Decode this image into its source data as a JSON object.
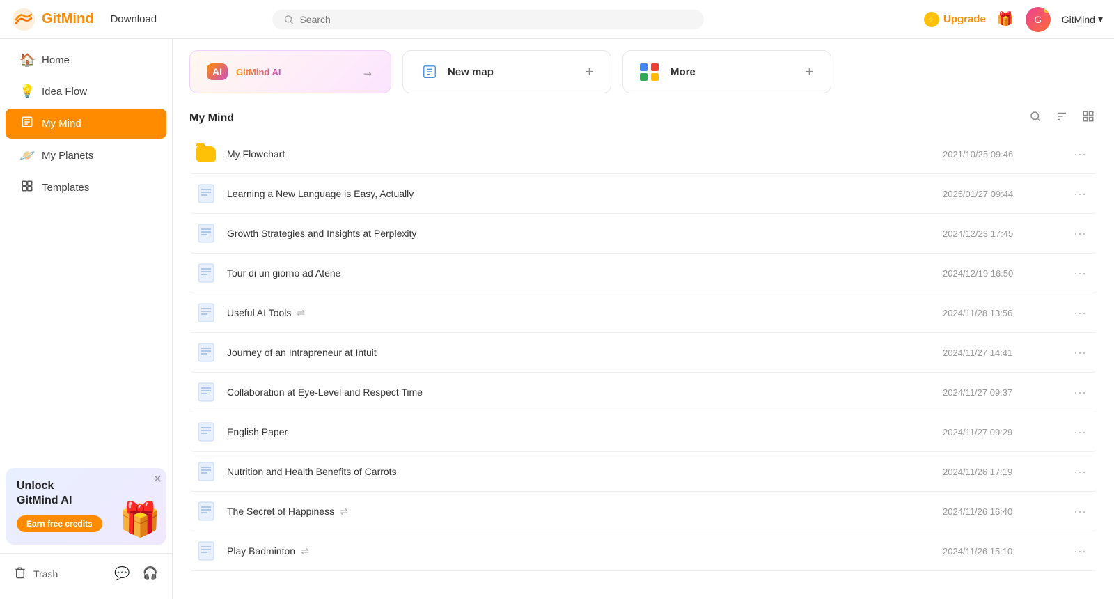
{
  "header": {
    "logo_text": "GitMind",
    "download_label": "Download",
    "search_placeholder": "Search",
    "upgrade_label": "Upgrade",
    "user_name": "GitMind",
    "user_chevron": "▾"
  },
  "sidebar": {
    "items": [
      {
        "id": "home",
        "label": "Home",
        "icon": "🏠"
      },
      {
        "id": "idea-flow",
        "label": "Idea Flow",
        "icon": "💡"
      },
      {
        "id": "my-mind",
        "label": "My Mind",
        "icon": "📋",
        "active": true
      },
      {
        "id": "my-planets",
        "label": "My Planets",
        "icon": "🪐"
      },
      {
        "id": "templates",
        "label": "Templates",
        "icon": "⊞"
      }
    ],
    "promo": {
      "title": "Unlock\nGitMind AI",
      "button": "Earn free credits"
    },
    "bottom": {
      "trash_label": "Trash",
      "chat_icon": "💬",
      "help_icon": "🎧"
    }
  },
  "quick_actions": {
    "ai_card": {
      "label": "GitMind AI",
      "icon": "AI",
      "arrow": "→"
    },
    "new_map_card": {
      "label": "New map",
      "plus": "+"
    },
    "more_card": {
      "label": "More",
      "plus": "+"
    }
  },
  "section": {
    "title": "My Mind"
  },
  "files": [
    {
      "name": "My Flowchart",
      "date": "2021/10/25 09:46",
      "type": "folder",
      "shared": false
    },
    {
      "name": "Learning a New Language is Easy, Actually",
      "date": "2025/01/27 09:44",
      "type": "doc",
      "shared": false
    },
    {
      "name": "Growth Strategies and Insights at Perplexity",
      "date": "2024/12/23 17:45",
      "type": "doc",
      "shared": false
    },
    {
      "name": "Tour di un giorno ad Atene",
      "date": "2024/12/19 16:50",
      "type": "doc",
      "shared": false
    },
    {
      "name": "Useful AI Tools",
      "date": "2024/11/28 13:56",
      "type": "doc",
      "shared": true
    },
    {
      "name": "Journey of an Intrapreneur at Intuit",
      "date": "2024/11/27 14:41",
      "type": "doc",
      "shared": false
    },
    {
      "name": "Collaboration at Eye-Level and Respect Time",
      "date": "2024/11/27 09:37",
      "type": "doc",
      "shared": false
    },
    {
      "name": "English Paper",
      "date": "2024/11/27 09:29",
      "type": "doc",
      "shared": false
    },
    {
      "name": "Nutrition and Health Benefits of Carrots",
      "date": "2024/11/26 17:19",
      "type": "doc",
      "shared": false
    },
    {
      "name": "The Secret of Happiness",
      "date": "2024/11/26 16:40",
      "type": "doc",
      "shared": true
    },
    {
      "name": "Play Badminton",
      "date": "2024/11/26 15:10",
      "type": "doc",
      "shared": true
    }
  ],
  "more_btn": "⋯",
  "search_icon": "🔍",
  "sort_icon": "↕",
  "view_icon": "⊞"
}
